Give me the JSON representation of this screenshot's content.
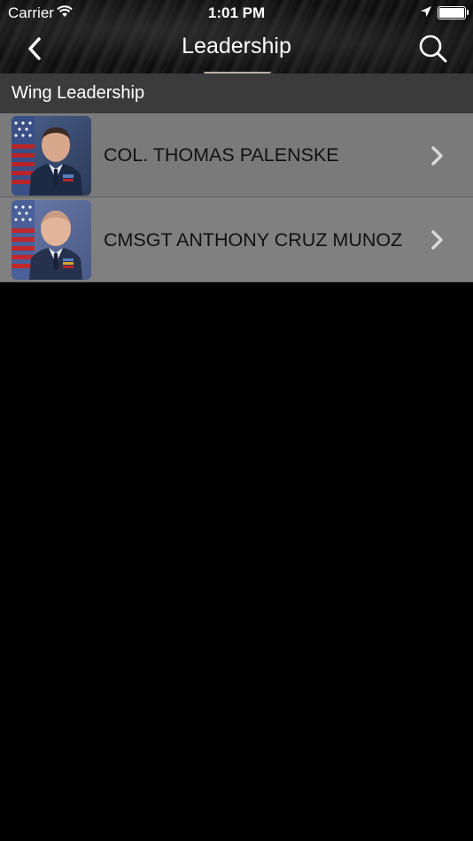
{
  "status_bar": {
    "carrier": "Carrier",
    "time": "1:01 PM"
  },
  "nav": {
    "title": "Leadership",
    "back_icon": "chevron-left-icon",
    "search_icon": "search-icon"
  },
  "section": {
    "title": "Wing Leadership"
  },
  "people": [
    {
      "name": "COL. THOMAS PALENSKE"
    },
    {
      "name": "CMSGT ANTHONY CRUZ MUNOZ"
    }
  ],
  "colors": {
    "background": "#000000",
    "section_header": "#3b3b3b",
    "row": "#7a7a7a",
    "text_dark": "#111111",
    "text_light": "#ffffff"
  }
}
